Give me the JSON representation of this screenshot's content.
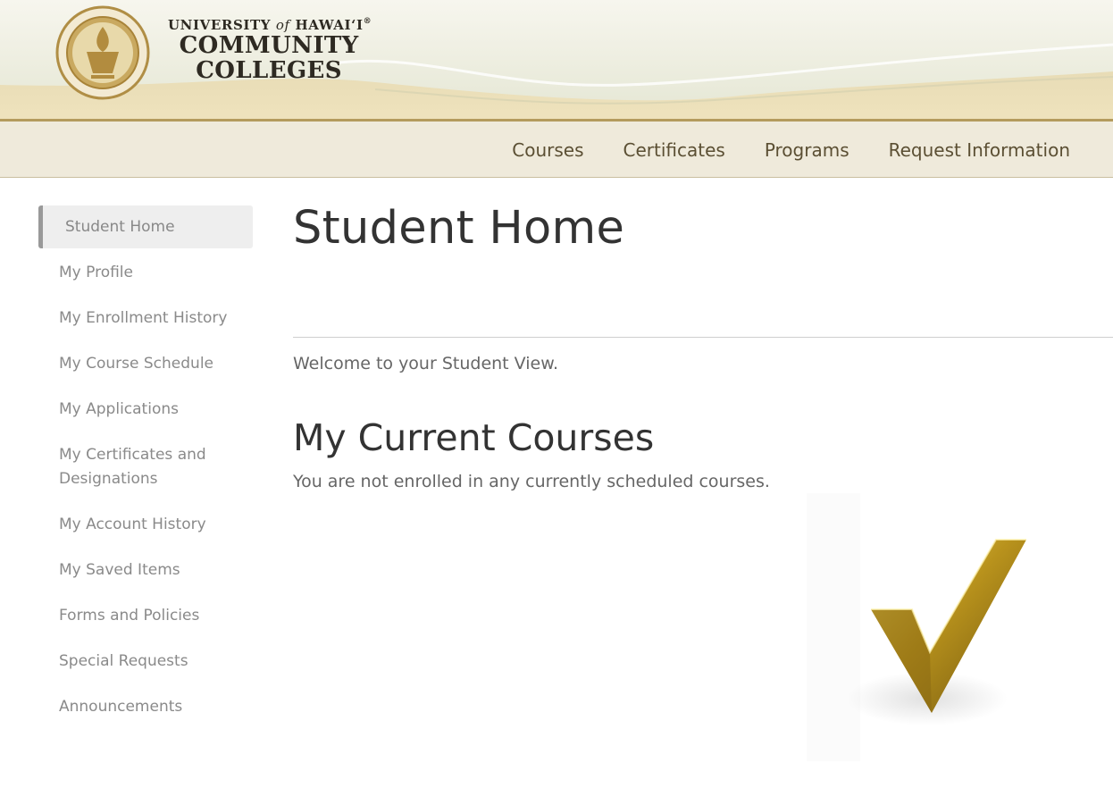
{
  "header": {
    "university_prefix": "UNIVERSITY",
    "university_of": "of",
    "university_suffix": "HAWAI‘I",
    "registered": "®",
    "line1": "COMMUNITY",
    "line2": "COLLEGES"
  },
  "topnav": {
    "items": [
      {
        "label": "Courses"
      },
      {
        "label": "Certificates"
      },
      {
        "label": "Programs"
      },
      {
        "label": "Request Information"
      }
    ]
  },
  "sidebar": {
    "items": [
      {
        "label": "Student Home",
        "active": true
      },
      {
        "label": "My Profile"
      },
      {
        "label": "My Enrollment History"
      },
      {
        "label": "My Course Schedule"
      },
      {
        "label": "My Applications"
      },
      {
        "label": "My Certificates and Designations"
      },
      {
        "label": "My Account History"
      },
      {
        "label": "My Saved Items"
      },
      {
        "label": "Forms and Policies"
      },
      {
        "label": "Special Requests"
      },
      {
        "label": "Announcements"
      }
    ]
  },
  "main": {
    "title": "Student Home",
    "welcome": "Welcome to your Student View.",
    "section_title": "My Current Courses",
    "empty_message": "You are not enrolled in any currently scheduled courses."
  },
  "icons": {
    "seal": "university-seal-icon",
    "checkmark": "gold-checkmark-icon"
  },
  "colors": {
    "brand_gold": "#b49b5d",
    "nav_bg": "#efeadb",
    "nav_text": "#5b4f33"
  }
}
